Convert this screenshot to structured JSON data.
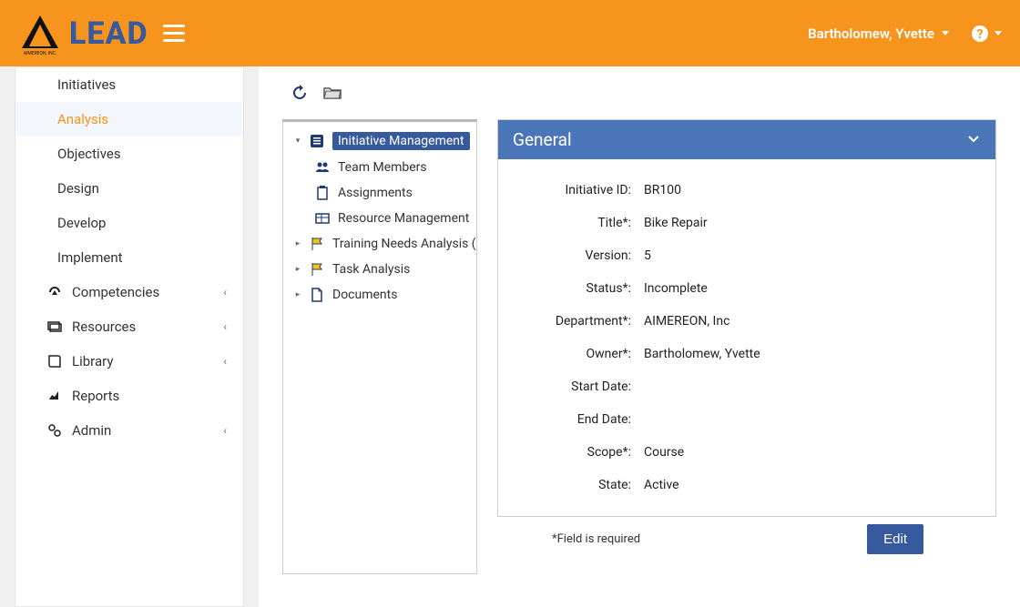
{
  "header": {
    "brand": "LEAD",
    "brand_sub": "AIMEREON, INC.",
    "user": "Bartholomew, Yvette"
  },
  "sidebar": {
    "sub_items": [
      {
        "label": "Initiatives",
        "active": false
      },
      {
        "label": "Analysis",
        "active": true
      },
      {
        "label": "Objectives",
        "active": false
      },
      {
        "label": "Design",
        "active": false
      },
      {
        "label": "Develop",
        "active": false
      },
      {
        "label": "Implement",
        "active": false
      }
    ],
    "sections": [
      {
        "label": "Competencies",
        "icon": "gauge"
      },
      {
        "label": "Resources",
        "icon": "cards"
      },
      {
        "label": "Library",
        "icon": "book"
      },
      {
        "label": "Reports",
        "icon": "chart"
      },
      {
        "label": "Admin",
        "icon": "gears"
      }
    ]
  },
  "tree": {
    "root": {
      "label": "Initiative Management",
      "icon": "list",
      "selected": true
    },
    "children": [
      {
        "label": "Team Members",
        "icon": "people"
      },
      {
        "label": "Assignments",
        "icon": "clipboard"
      },
      {
        "label": "Resource Management",
        "icon": "grid"
      }
    ],
    "siblings": [
      {
        "label": "Training Needs Analysis (C",
        "icon": "flag"
      },
      {
        "label": "Task Analysis",
        "icon": "flag"
      },
      {
        "label": "Documents",
        "icon": "doc"
      }
    ]
  },
  "panel": {
    "title": "General",
    "fields": [
      {
        "label": "Initiative ID:",
        "value": "BR100"
      },
      {
        "label": "Title*:",
        "value": "Bike Repair"
      },
      {
        "label": "Version:",
        "value": "5"
      },
      {
        "label": "Status*:",
        "value": "Incomplete"
      },
      {
        "label": "Department*:",
        "value": "AIMEREON, Inc"
      },
      {
        "label": "Owner*:",
        "value": "Bartholomew, Yvette"
      },
      {
        "label": "Start Date:",
        "value": ""
      },
      {
        "label": "End Date:",
        "value": ""
      },
      {
        "label": "Scope*:",
        "value": "Course"
      },
      {
        "label": "State:",
        "value": "Active"
      }
    ],
    "required_note": "*Field is required",
    "edit_label": "Edit"
  }
}
